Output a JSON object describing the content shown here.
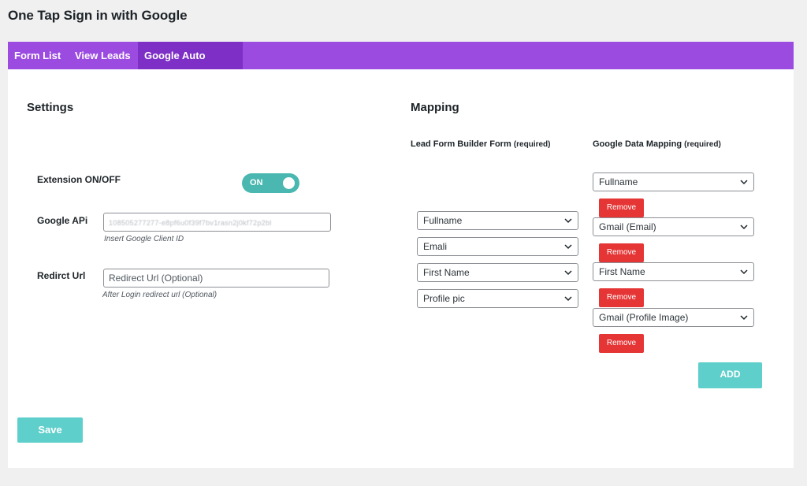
{
  "page": {
    "title": "One Tap Sign in with Google"
  },
  "tabs": [
    {
      "label": "Form List"
    },
    {
      "label": "View Leads"
    },
    {
      "label": "Google Auto Signin",
      "active": true
    }
  ],
  "settings": {
    "title": "Settings",
    "extension": {
      "label": "Extension ON/OFF",
      "toggle_text": "ON",
      "state": "on"
    },
    "google_api": {
      "label": "Google APi",
      "value": "108505277277-e8pf6u0f39f7bv1rasn2j0kf72p2bl",
      "hint": "Insert Google Client ID"
    },
    "redirect": {
      "label": "Redirct Url",
      "placeholder": "Redirect Url (Optional)",
      "hint": "After Login redirect url (Optional)"
    },
    "save_label": "Save"
  },
  "mapping": {
    "title": "Mapping",
    "col1_head": "Lead Form Builder Form",
    "col2_head": "Google Data Mapping",
    "required": "(required)",
    "lead_fields": [
      "Fullname",
      "Emali",
      "First Name",
      "Profile pic"
    ],
    "google_fields": [
      "Fullname",
      "Gmail (Email)",
      "First Name",
      "Gmail (Profile Image)"
    ],
    "remove_label": "Remove",
    "add_label": "ADD"
  },
  "colors": {
    "tab_bar": "#9b4be0",
    "tab_active": "#7d2fc6",
    "toggle_on": "#4ab8b0",
    "teal_button": "#5ecfcb",
    "remove_red": "#e53535"
  }
}
